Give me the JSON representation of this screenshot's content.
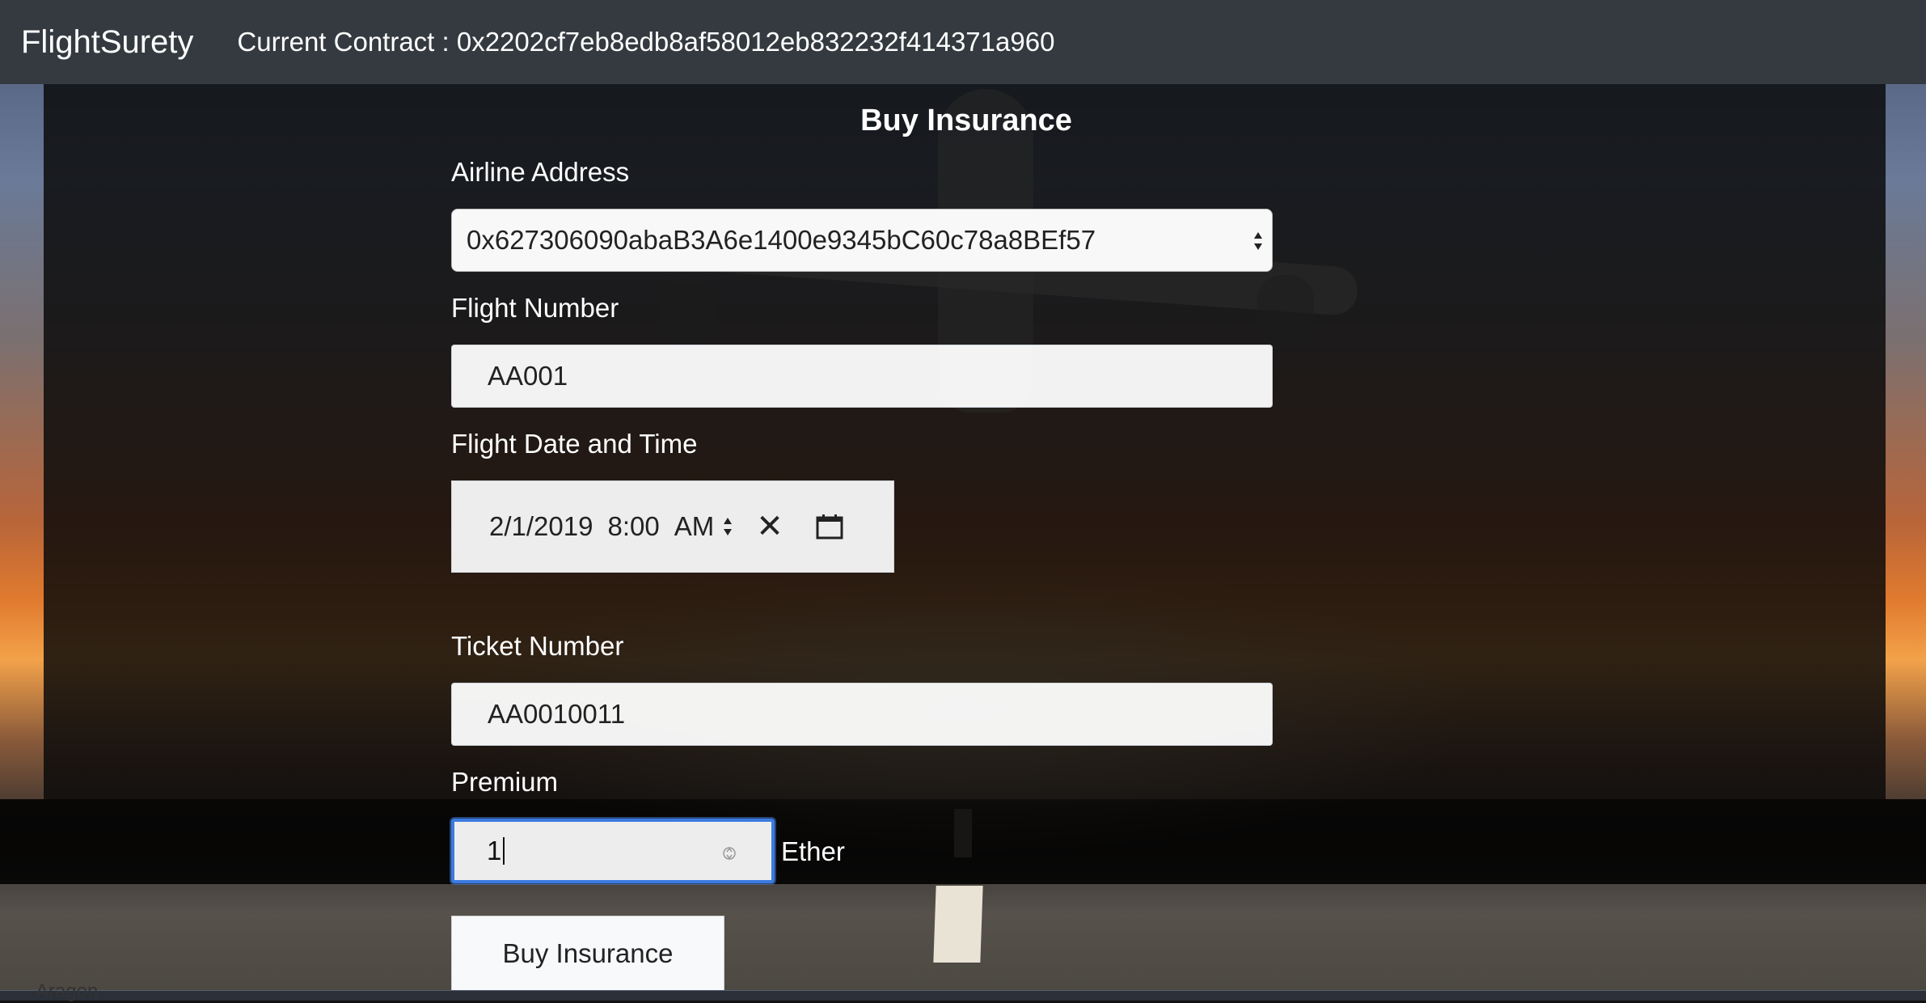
{
  "navbar": {
    "brand": "FlightSurety",
    "contract_label": "Current Contract : 0x2202cf7eb8edb8af58012eb832232f414371a960"
  },
  "form": {
    "title": "Buy Insurance",
    "airline": {
      "label": "Airline Address",
      "selected_value": "0x627306090abaB3A6e1400e9345bC60c78a8BEf57"
    },
    "flight_number": {
      "label": "Flight Number",
      "value": "AA001"
    },
    "flight_datetime": {
      "label": "Flight Date and Time",
      "date": "2/1/2019",
      "time": "8:00",
      "ampm": "AM"
    },
    "ticket_number": {
      "label": "Ticket Number",
      "value": "AA0010011"
    },
    "premium": {
      "label": "Premium",
      "value": "1",
      "unit": "Ether"
    },
    "submit_label": "Buy Insurance"
  },
  "dock": {
    "partial_text": "Aragon"
  },
  "colors": {
    "navbar_bg": "#343a40",
    "focus_border": "#3b7be0"
  }
}
